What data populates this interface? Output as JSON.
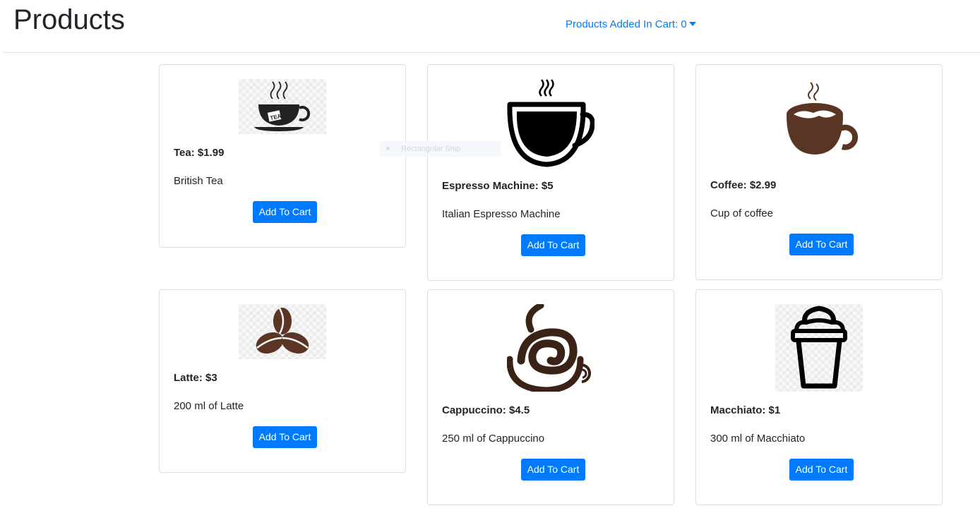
{
  "header": {
    "title": "Products",
    "cart_label": "Products Added In Cart: 0"
  },
  "products": [
    {
      "title": "Tea: $1.99",
      "description": "British Tea",
      "button": "Add To Cart",
      "icon": "tea-cup-icon"
    },
    {
      "title": "Espresso Machine: $5",
      "description": "Italian Espresso Machine",
      "button": "Add To Cart",
      "icon": "espresso-cup-icon"
    },
    {
      "title": "Coffee: $2.99",
      "description": "Cup of coffee",
      "button": "Add To Cart",
      "icon": "coffee-cup-icon"
    },
    {
      "title": "Latte: $3",
      "description": "200 ml of Latte",
      "button": "Add To Cart",
      "icon": "coffee-beans-icon"
    },
    {
      "title": "Cappuccino: $4.5",
      "description": "250 ml of Cappuccino",
      "button": "Add To Cart",
      "icon": "cappuccino-swirl-icon"
    },
    {
      "title": "Macchiato: $1",
      "description": "300 ml of Macchiato",
      "button": "Add To Cart",
      "icon": "takeaway-cup-icon"
    }
  ],
  "overlay": {
    "snip_label": "Rectangular Snip"
  },
  "colors": {
    "accent": "#007bff",
    "coffee_brown": "#5a3523",
    "text": "#212529",
    "border": "#dfdfdf"
  }
}
